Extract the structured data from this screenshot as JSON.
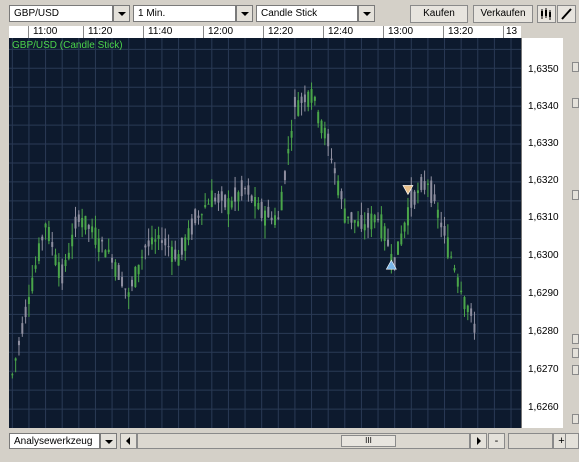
{
  "toolbar": {
    "symbol": "GBP/USD",
    "interval": "1 Min.",
    "chart_type": "Candle Stick",
    "buy_label": "Kaufen",
    "sell_label": "Verkaufen"
  },
  "chart": {
    "title": "GBP/USD (Candle Stick)",
    "time_labels": [
      "11:00",
      "11:20",
      "11:40",
      "12:00",
      "12:20",
      "12:40",
      "13:00",
      "13:20",
      "13"
    ],
    "price_labels": [
      "1,6350",
      "1,6340",
      "1,6330",
      "1,6320",
      "1,6310",
      "1,6300",
      "1,6290",
      "1,6280",
      "1,6270",
      "1,6260"
    ],
    "colors": {
      "background": "#0d1a2e",
      "grid": "#2a3a55",
      "up": "#4aa64a",
      "down": "#8f8fa0",
      "title": "#4cd44c"
    }
  },
  "bottom": {
    "tool_label": "Analysewerkzeug",
    "scroll_grip": "III",
    "zoom_out": "-",
    "zoom_in": "+"
  },
  "chart_data": {
    "type": "candlestick",
    "title": "GBP/USD (Candle Stick)",
    "x_range": [
      "10:54",
      "13:28"
    ],
    "ylim": [
      1.6255,
      1.6358
    ],
    "series": [
      {
        "time": "10:55",
        "close": 1.6269
      },
      {
        "time": "11:00",
        "close": 1.629
      },
      {
        "time": "11:05",
        "close": 1.6309
      },
      {
        "time": "11:10",
        "close": 1.6295
      },
      {
        "time": "11:15",
        "close": 1.6311
      },
      {
        "time": "11:20",
        "close": 1.6306
      },
      {
        "time": "11:25",
        "close": 1.63
      },
      {
        "time": "11:30",
        "close": 1.629
      },
      {
        "time": "11:35",
        "close": 1.6303
      },
      {
        "time": "11:40",
        "close": 1.6305
      },
      {
        "time": "11:45",
        "close": 1.63
      },
      {
        "time": "11:50",
        "close": 1.631
      },
      {
        "time": "11:55",
        "close": 1.6316
      },
      {
        "time": "12:00",
        "close": 1.6314
      },
      {
        "time": "12:05",
        "close": 1.6318
      },
      {
        "time": "12:10",
        "close": 1.6312
      },
      {
        "time": "12:15",
        "close": 1.631
      },
      {
        "time": "12:20",
        "close": 1.634
      },
      {
        "time": "12:25",
        "close": 1.6344
      },
      {
        "time": "12:30",
        "close": 1.633
      },
      {
        "time": "12:35",
        "close": 1.6312
      },
      {
        "time": "12:40",
        "close": 1.6308
      },
      {
        "time": "12:45",
        "close": 1.6311
      },
      {
        "time": "12:50",
        "close": 1.6299
      },
      {
        "time": "12:55",
        "close": 1.6315
      },
      {
        "time": "13:00",
        "close": 1.632
      },
      {
        "time": "13:05",
        "close": 1.6306
      },
      {
        "time": "13:10",
        "close": 1.6292
      },
      {
        "time": "13:15",
        "close": 1.6279
      }
    ],
    "markers": [
      {
        "type": "buy",
        "time": "12:49",
        "price": 1.6298
      },
      {
        "type": "sell",
        "time": "12:54",
        "price": 1.6318
      }
    ]
  }
}
